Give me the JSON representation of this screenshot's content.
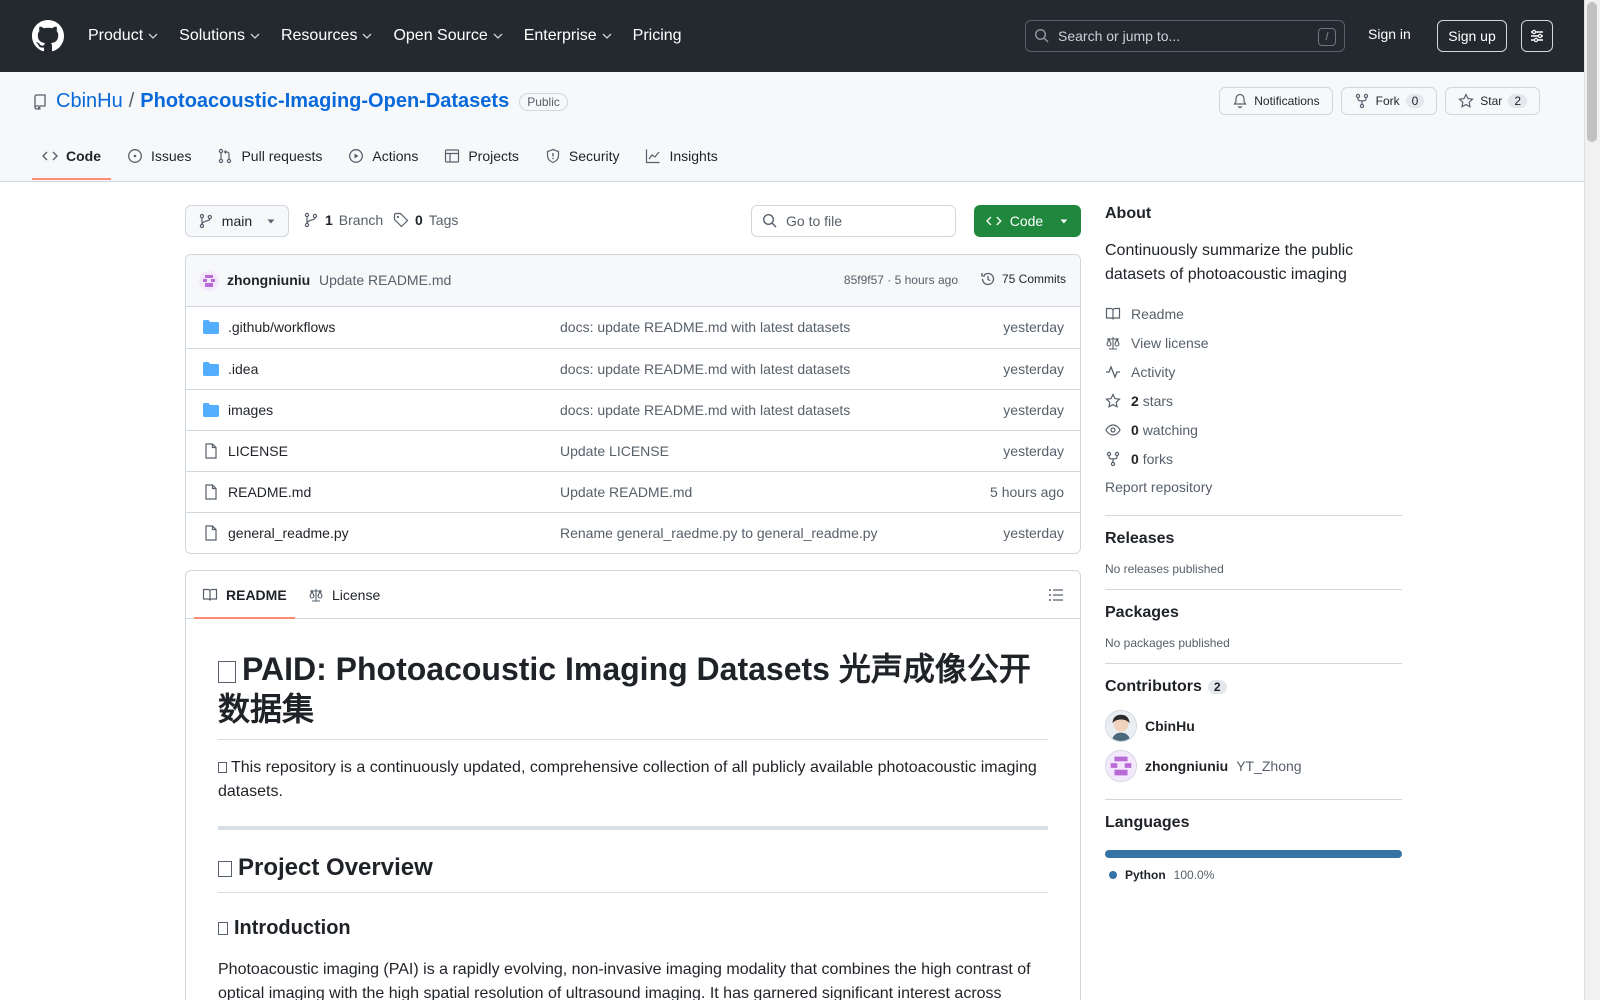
{
  "header": {
    "nav": [
      {
        "label": "Product",
        "has_menu": true
      },
      {
        "label": "Solutions",
        "has_menu": true
      },
      {
        "label": "Resources",
        "has_menu": true
      },
      {
        "label": "Open Source",
        "has_menu": true
      },
      {
        "label": "Enterprise",
        "has_menu": true
      },
      {
        "label": "Pricing",
        "has_menu": false
      }
    ],
    "search_placeholder": "Search or jump to...",
    "search_shortcut": "/",
    "sign_in": "Sign in",
    "sign_up": "Sign up"
  },
  "repo": {
    "owner": "CbinHu",
    "separator": "/",
    "name": "Photoacoustic-Imaging-Open-Datasets",
    "visibility": "Public",
    "notifications_label": "Notifications",
    "fork_label": "Fork",
    "fork_count": "0",
    "star_label": "Star",
    "star_count": "2",
    "tabs": [
      {
        "label": "Code",
        "icon": "code-icon",
        "active": true
      },
      {
        "label": "Issues",
        "icon": "issue-icon",
        "active": false
      },
      {
        "label": "Pull requests",
        "icon": "pull-request-icon",
        "active": false
      },
      {
        "label": "Actions",
        "icon": "play-icon",
        "active": false
      },
      {
        "label": "Projects",
        "icon": "table-icon",
        "active": false
      },
      {
        "label": "Security",
        "icon": "shield-icon",
        "active": false
      },
      {
        "label": "Insights",
        "icon": "graph-icon",
        "active": false
      }
    ]
  },
  "toolbar": {
    "branch": "main",
    "branch_count": "1",
    "branch_label": "Branch",
    "tag_count": "0",
    "tag_label": "Tags",
    "goto_placeholder": "Go to file",
    "code_button": "Code"
  },
  "latest_commit": {
    "author": "zhongniuniu",
    "message": "Update README.md",
    "meta": "85f9f57 · 5 hours ago",
    "commits": "75 Commits"
  },
  "files": [
    {
      "name": ".github/workflows",
      "type": "folder",
      "message": "docs: update README.md with latest datasets",
      "date": "yesterday"
    },
    {
      "name": ".idea",
      "type": "folder",
      "message": "docs: update README.md with latest datasets",
      "date": "yesterday"
    },
    {
      "name": "images",
      "type": "folder",
      "message": "docs: update README.md with latest datasets",
      "date": "yesterday"
    },
    {
      "name": "LICENSE",
      "type": "file",
      "message": "Update LICENSE",
      "date": "yesterday"
    },
    {
      "name": "README.md",
      "type": "file",
      "message": "Update README.md",
      "date": "5 hours ago"
    },
    {
      "name": "general_readme.py",
      "type": "file",
      "message": "Rename general_raedme.py to general_readme.py",
      "date": "yesterday"
    }
  ],
  "readme": {
    "tab_readme": "README",
    "tab_license": "License",
    "h1": "PAID: Photoacoustic Imaging Datasets 光声成像公开数据集",
    "intro": "This repository is a continuously updated, comprehensive collection of all publicly available photoacoustic imaging datasets.",
    "h2": "Project Overview",
    "h3": "Introduction",
    "p2": "Photoacoustic imaging (PAI) is a rapidly evolving, non-invasive imaging modality that combines the high contrast of optical imaging with the high spatial resolution of ultrasound imaging. It has garnered significant interest across"
  },
  "sidebar": {
    "about_title": "About",
    "about_desc": "Continuously summarize the public datasets of photoacoustic imaging",
    "links": [
      {
        "icon": "book-icon",
        "strong": "",
        "label": "Readme"
      },
      {
        "icon": "law-icon",
        "strong": "",
        "label": "View license"
      },
      {
        "icon": "pulse-icon",
        "strong": "",
        "label": "Activity"
      },
      {
        "icon": "star-icon",
        "strong": "2",
        "label": "stars"
      },
      {
        "icon": "eye-icon",
        "strong": "0",
        "label": "watching"
      },
      {
        "icon": "fork-icon",
        "strong": "0",
        "label": "forks"
      }
    ],
    "report": "Report repository",
    "releases_title": "Releases",
    "releases_empty": "No releases published",
    "packages_title": "Packages",
    "packages_empty": "No packages published",
    "contributors_title": "Contributors",
    "contributors_count": "2",
    "contributors": [
      {
        "name": "CbinHu",
        "handle": ""
      },
      {
        "name": "zhongniuniu",
        "handle": "YT_Zhong"
      }
    ],
    "languages_title": "Languages",
    "languages": [
      {
        "name": "Python",
        "percent": "100.0%",
        "color": "#3572a5"
      }
    ]
  },
  "colors": {
    "header_bg": "#24292f",
    "link": "#0969da",
    "code_button": "#1f883d",
    "active_tab_underline": "#fd8c73"
  }
}
